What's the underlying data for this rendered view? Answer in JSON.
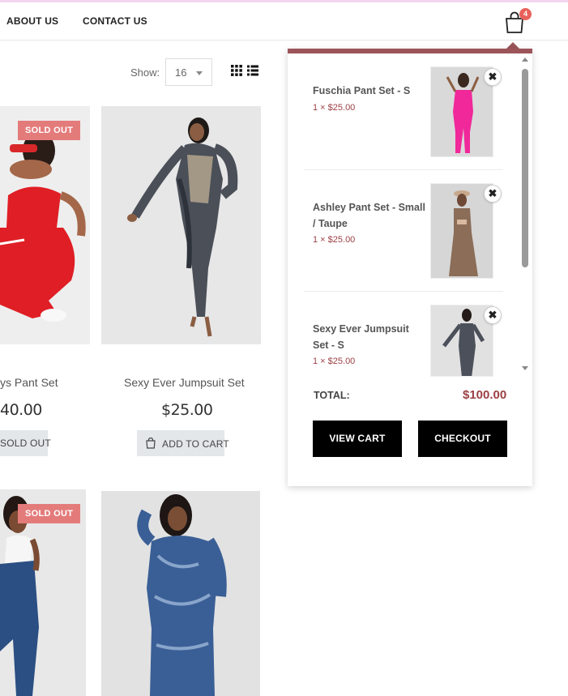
{
  "nav": {
    "about": "ABOUT US",
    "contact": "CONTACT US",
    "cart_count": "4"
  },
  "toolbar": {
    "show_label": "Show:",
    "show_value": "16"
  },
  "products": [
    {
      "title": "ys Pant Set",
      "price": "40.00",
      "badge": "SOLD OUT",
      "button": "SOLD OUT"
    },
    {
      "title": "Sexy Ever Jumpsuit Set",
      "price": "$25.00",
      "button": "ADD TO CART"
    },
    {
      "badge": "SOLD OUT"
    },
    {}
  ],
  "cart": {
    "items": [
      {
        "name": "Fuschia Pant Set - S",
        "qty": "1 × $25.00",
        "remove": "✖"
      },
      {
        "name": "Ashley Pant Set - Small / Taupe",
        "qty": "1 × $25.00",
        "remove": "✖"
      },
      {
        "name": "Sexy Ever Jumpsuit Set - S",
        "qty": "1 × $25.00",
        "remove": "✖"
      }
    ],
    "total_label": "TOTAL:",
    "total_value": "$100.00",
    "view_cart": "VIEW CART",
    "checkout": "CHECKOUT"
  },
  "colors": {
    "accent": "#9b5559",
    "price_accent": "#9b3f44",
    "badge": "#e47b7b",
    "cart_badge": "#e8615a"
  }
}
